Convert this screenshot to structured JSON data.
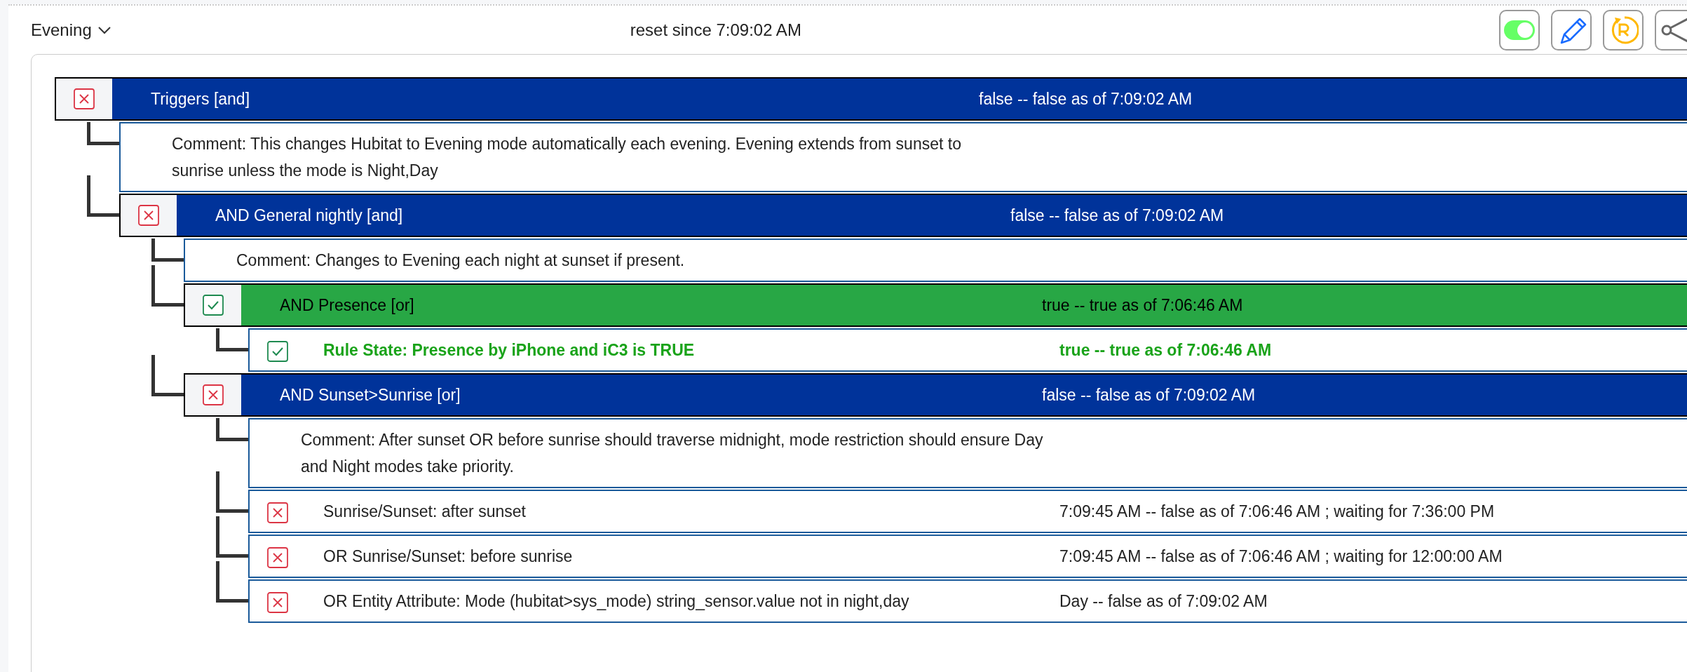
{
  "header": {
    "mode_label": "Evening",
    "status": "reset since 7:09:02 AM",
    "buttons": [
      {
        "kind": "toggle",
        "on": true
      },
      {
        "kind": "edit"
      },
      {
        "kind": "reset"
      },
      {
        "kind": "share"
      }
    ]
  },
  "tree": {
    "kind": "group",
    "label": "Triggers [and]",
    "value": "false -- false as of 7:09:02 AM",
    "passed": false,
    "children": [
      {
        "kind": "comment",
        "text": "Comment: This changes Hubitat to Evening mode automatically each evening. Evening extends from sunset to sunrise unless the mode is Night,Day"
      },
      {
        "kind": "group",
        "label": "AND General nightly [and]",
        "value": "false -- false as of 7:09:02 AM",
        "passed": false,
        "children": [
          {
            "kind": "comment",
            "text": "Comment: Changes to Evening each night at sunset if present."
          },
          {
            "kind": "group",
            "label": "AND Presence [or]",
            "value": "true -- true as of 7:06:46 AM",
            "passed": true,
            "children": [
              {
                "kind": "condition",
                "label": "Rule State: Presence by iPhone and iC3 is TRUE",
                "value": "true -- true as of 7:06:46 AM",
                "passed": true
              }
            ]
          },
          {
            "kind": "group",
            "label": "AND Sunset>Sunrise [or]",
            "value": "false -- false as of 7:09:02 AM",
            "passed": false,
            "children": [
              {
                "kind": "comment",
                "text": "Comment: After sunset OR before sunrise should traverse midnight, mode restriction should ensure Day and Night modes take priority."
              },
              {
                "kind": "condition",
                "label": "Sunrise/Sunset: after sunset",
                "value": "7:09:45 AM -- false as of 7:06:46 AM ; waiting for 7:36:00 PM",
                "passed": false
              },
              {
                "kind": "condition",
                "label": "OR Sunrise/Sunset: before sunrise",
                "value": "7:09:45 AM -- false as of 7:06:46 AM ; waiting for 12:00:00 AM",
                "passed": false
              },
              {
                "kind": "condition",
                "label": "OR Entity Attribute: Mode (hubitat>sys_mode) string_sensor.value not in night,day",
                "value": "Day -- false as of 7:09:02 AM",
                "passed": false
              }
            ]
          }
        ]
      }
    ]
  }
}
